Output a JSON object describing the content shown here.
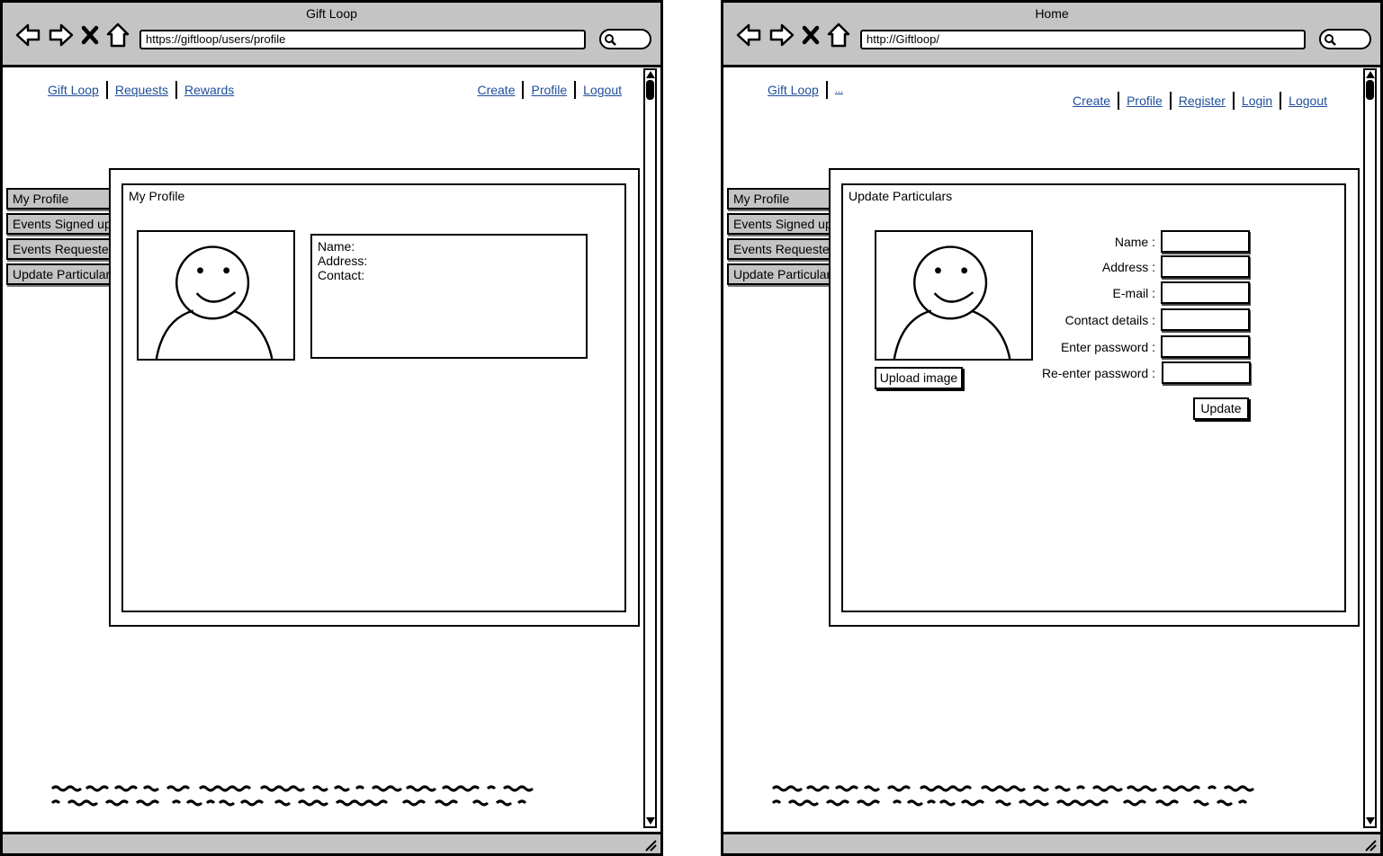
{
  "left_window": {
    "title": "Gift Loop",
    "url": "https://giftloop/users/profile",
    "nav_left": [
      "Gift Loop",
      "Requests",
      "Rewards"
    ],
    "nav_right": [
      "Create",
      "Profile",
      "Logout"
    ],
    "side_tabs": [
      "My Profile",
      "Events Signed up",
      "Events Requested",
      "Update Particulars"
    ],
    "panel_title": "My Profile",
    "info_lines": [
      "Name:",
      "Address:",
      "Contact:"
    ]
  },
  "right_window": {
    "title": "Home",
    "url": "http://Giftloop/",
    "nav_left": [
      "Gift Loop",
      "..."
    ],
    "nav_right": [
      "Create",
      "Profile",
      "Register",
      "Login",
      "Logout"
    ],
    "side_tabs": [
      "My Profile",
      "Events Signed up",
      "Events Requested",
      "Update Particulars"
    ],
    "panel_title": "Update Particulars",
    "upload_label": "Upload image",
    "form_labels": [
      "Name :",
      "Address :",
      "E-mail :",
      "Contact details :",
      "Enter password :",
      "Re-enter password :"
    ],
    "update_label": "Update"
  },
  "icons": {
    "back": "arrow-left-icon",
    "forward": "arrow-right-icon",
    "stop": "close-icon",
    "home": "home-icon",
    "search": "search-icon",
    "avatar": "user-avatar-icon"
  },
  "colors": {
    "chrome": "#c4c4c4",
    "link": "#1f4e9a",
    "border": "#000000"
  }
}
